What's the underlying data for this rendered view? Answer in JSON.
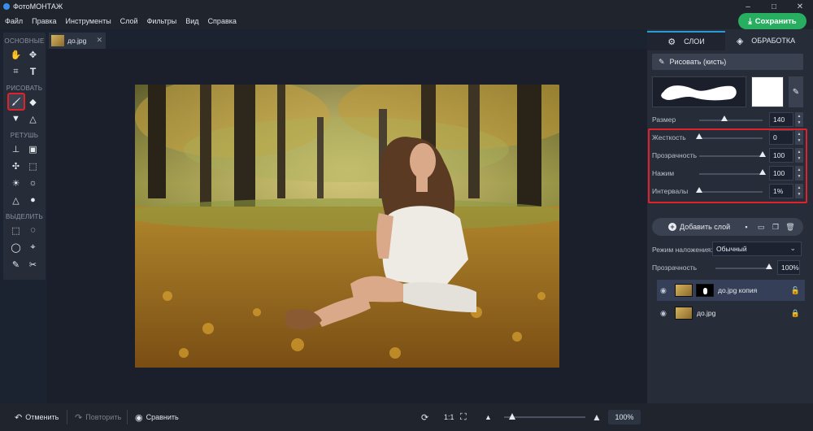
{
  "app": {
    "title": "ФотоМОНТАЖ"
  },
  "window": {
    "minimize": "–",
    "maximize": "□",
    "close": "✕"
  },
  "menu": [
    "Файл",
    "Правка",
    "Инструменты",
    "Слой",
    "Фильтры",
    "Вид",
    "Справка"
  ],
  "save_button": "Сохранить",
  "toolbox": {
    "sections": [
      {
        "title": "ОСНОВНЫЕ",
        "tools": [
          "hand-icon",
          "move-icon",
          "crop-icon",
          "text-icon"
        ]
      },
      {
        "title": "РИСОВАТЬ",
        "tools": [
          "brush-icon",
          "eraser-icon",
          "fill-icon",
          "shapes-icon"
        ]
      },
      {
        "title": "РЕТУШЬ",
        "tools": [
          "stamp-icon",
          "patch-icon",
          "healing-icon",
          "frame-icon",
          "brightness-icon",
          "dodge-icon",
          "sharpen-icon",
          "blur-drop-icon"
        ]
      },
      {
        "title": "ВЫДЕЛИТЬ",
        "tools": [
          "rect-select-icon",
          "ellipse-select-icon",
          "lasso-icon",
          "polygon-lasso-icon",
          "magic-select-icon",
          "brush-select-icon"
        ]
      }
    ],
    "active_tool": "brush-icon"
  },
  "document": {
    "tab_name": "до.jpg",
    "close": "✕"
  },
  "bottom": {
    "undo": "Отменить",
    "redo": "Повторить",
    "compare": "Сравнить",
    "ratio": "1:1",
    "zoom": "100%",
    "zoom_level": 0.06
  },
  "panel": {
    "tabs": [
      {
        "label": "СЛОИ"
      },
      {
        "label": "ОБРАБОТКА"
      }
    ],
    "brush_button": "Рисовать (кисть)",
    "params": [
      {
        "label": "Размер",
        "value": "140",
        "fraction": 0.4
      },
      {
        "label": "Жесткость",
        "value": "0",
        "fraction": 0.0
      },
      {
        "label": "Прозрачность",
        "value": "100",
        "fraction": 1.0
      },
      {
        "label": "Нажим",
        "value": "100",
        "fraction": 1.0
      },
      {
        "label": "Интервалы",
        "value": "1%",
        "fraction": 0.0
      }
    ],
    "add_layer": "Добавить слой",
    "blend_label": "Режим наложения:",
    "blend_value": "Обычный",
    "opacity_label": "Прозрачность",
    "opacity_value": "100%",
    "opacity_fraction": 1.0,
    "layers": [
      {
        "name": "до.jpg копия",
        "selected": true
      },
      {
        "name": "до.jpg",
        "selected": false
      }
    ]
  },
  "colors": {
    "accent": "#27ae60",
    "highlight": "#e0222b",
    "tab_accent": "#2b9bd8"
  }
}
